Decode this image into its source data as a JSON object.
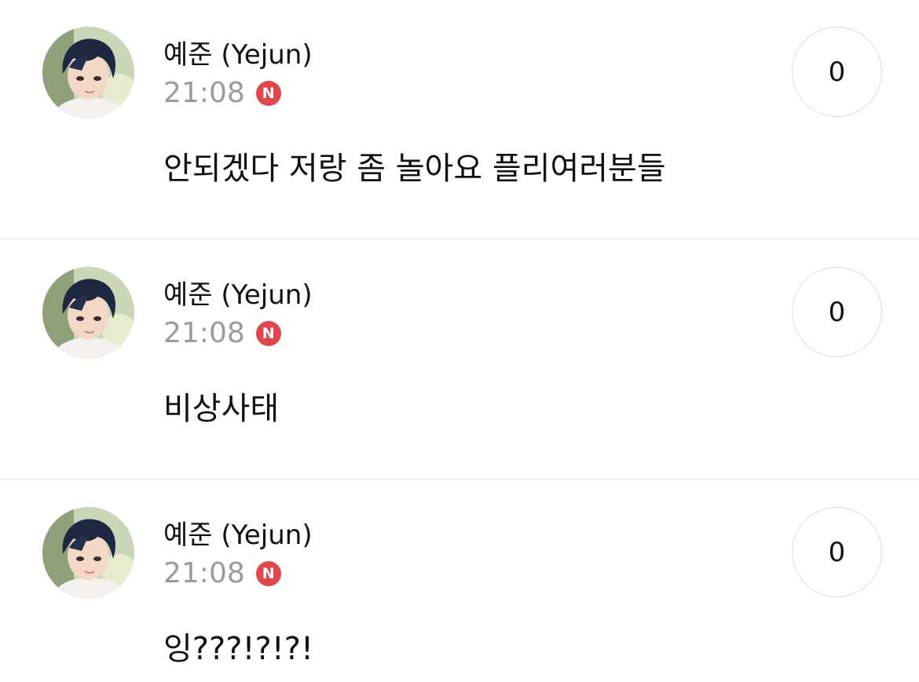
{
  "colors": {
    "badge": "#e0474c",
    "time": "#9b9b9b",
    "divider": "#e3e3e3"
  },
  "posts": [
    {
      "author": "예준 (Yejun)",
      "time": "21:08",
      "badge": "N",
      "reply_count": "0",
      "message": "안되겠다 저랑 좀 놀아요 플리여러분들"
    },
    {
      "author": "예준 (Yejun)",
      "time": "21:08",
      "badge": "N",
      "reply_count": "0",
      "message": "비상사태"
    },
    {
      "author": "예준 (Yejun)",
      "time": "21:08",
      "badge": "N",
      "reply_count": "0",
      "message": "잉???!?!?!"
    }
  ]
}
